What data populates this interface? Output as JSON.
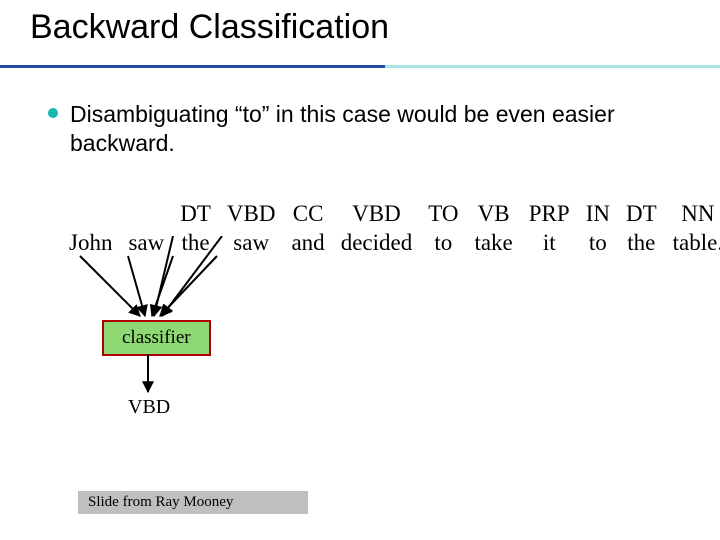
{
  "title": "Backward Classification",
  "bullet": "Disambiguating “to” in this case would be even easier backward.",
  "pos": [
    "",
    "",
    "DT",
    "VBD",
    "CC",
    "VBD",
    "TO",
    "VB",
    "PRP",
    "IN",
    "DT",
    "NN"
  ],
  "words": [
    "John",
    "saw",
    "the",
    "saw",
    "and",
    "decided",
    "to",
    "take",
    "it",
    "to",
    "the",
    "table."
  ],
  "classifier_label": "classifier",
  "output_tag": "VBD",
  "footer": "Slide from Ray Mooney"
}
